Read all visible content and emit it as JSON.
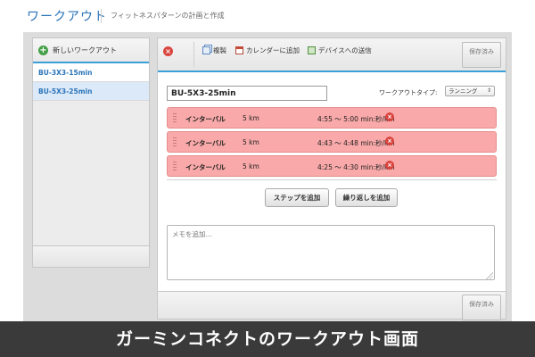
{
  "header": {
    "title": "ワークアウト",
    "subtitle": "フィットネスパターンの計画と作成"
  },
  "sidebar": {
    "new_workout_label": "新しいワークアウト",
    "items": [
      {
        "label": "BU-3X3-15min",
        "selected": false
      },
      {
        "label": "BU-5X3-25min",
        "selected": true
      }
    ]
  },
  "toolbar": {
    "copy_label": "複製",
    "calendar_label": "カレンダーに追加",
    "send_label": "デバイスへの送信",
    "saved_label": "保存済み"
  },
  "workout": {
    "name": "BU-5X3-25min",
    "type_label": "ワークアウトタイプ:",
    "type_value": "ランニング",
    "steps": [
      {
        "type": "インターバル",
        "distance": "5 km",
        "pace": "4:55 ～ 5:00 min:秒/km"
      },
      {
        "type": "インターバル",
        "distance": "5 km",
        "pace": "4:43 ～ 4:48 min:秒/km"
      },
      {
        "type": "インターバル",
        "distance": "5 km",
        "pace": "4:25 ～ 4:30 min:秒/km"
      }
    ],
    "add_step_label": "ステップを追加",
    "add_repeat_label": "繰り返しを追加",
    "memo_placeholder": "メモを追加..."
  },
  "footer": {
    "saved_label": "保存済み"
  },
  "caption": "ガーミンコネクトのワークアウト画面",
  "colors": {
    "accent": "#2a74b8",
    "step_bg": "#f9a9a9",
    "delete_red": "#d9453e",
    "add_green": "#43a047"
  }
}
